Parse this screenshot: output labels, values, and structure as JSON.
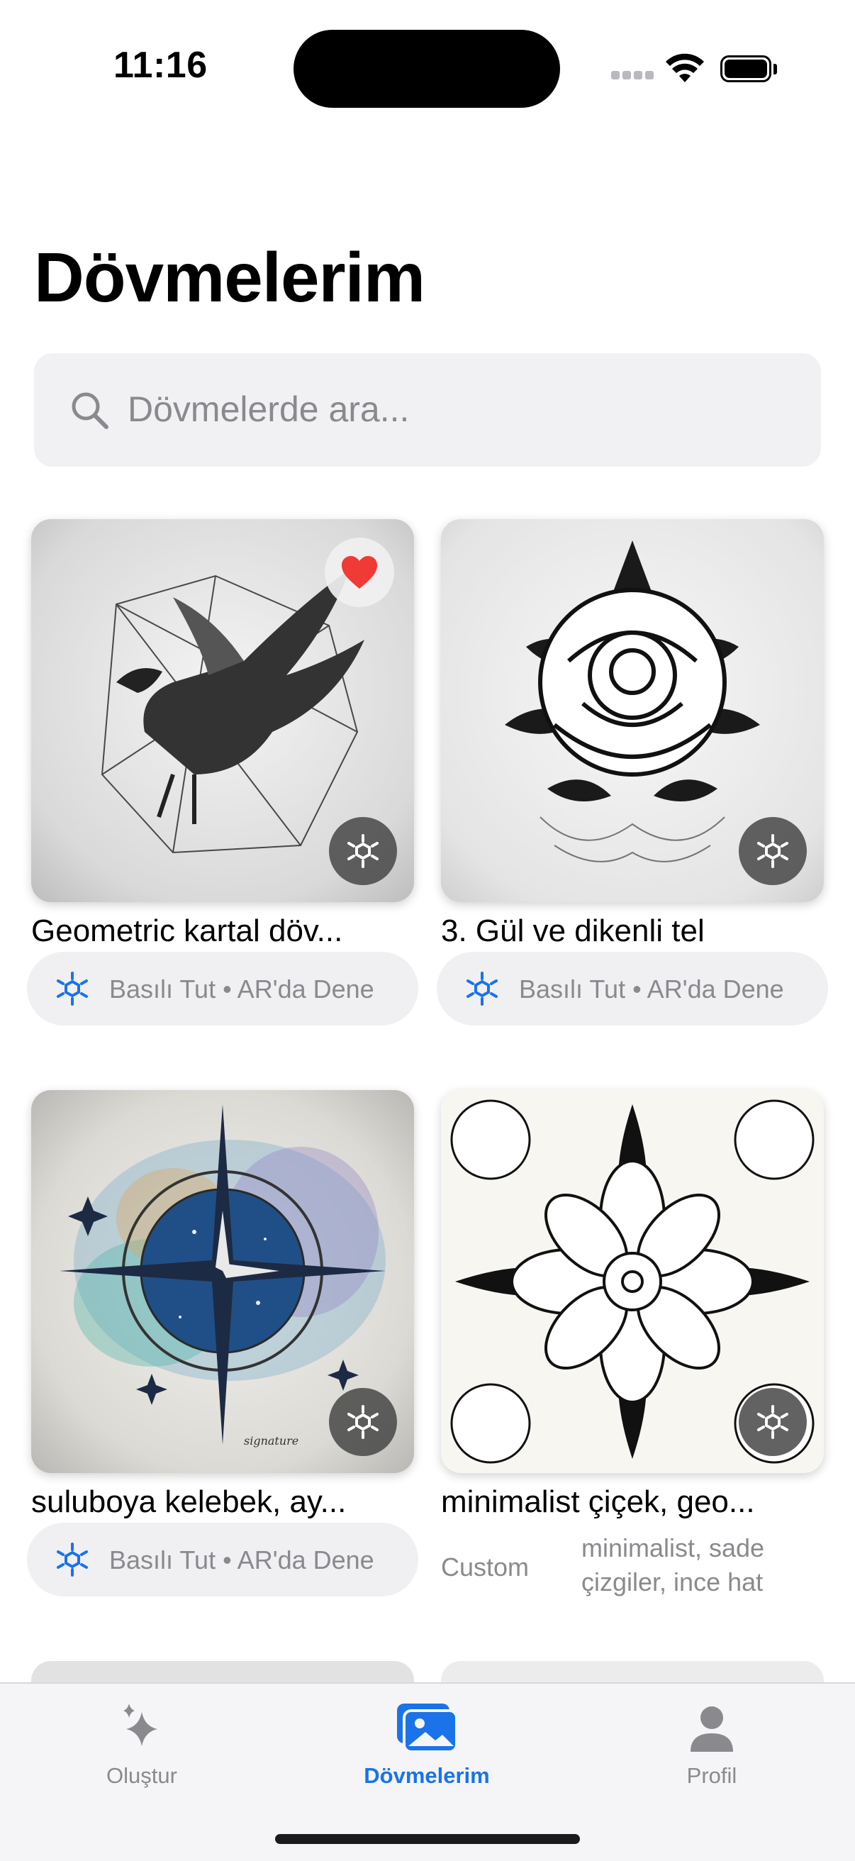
{
  "status": {
    "time": "11:16"
  },
  "header": {
    "title": "Dövmelerim"
  },
  "search": {
    "placeholder": "Dövmelerde ara..."
  },
  "cards": [
    {
      "title": "Geometric kartal döv...",
      "favorited": true,
      "ar_label": "Basılı Tut • AR'da Dene"
    },
    {
      "title": "3. Gül ve dikenli tel",
      "favorited": false,
      "ar_label": "Basılı Tut • AR'da Dene"
    },
    {
      "title": "suluboya kelebek, ay...",
      "favorited": false,
      "ar_label": "Basılı Tut • AR'da Dene"
    },
    {
      "title": "minimalist çiçek, geo...",
      "favorited": false,
      "style": "Custom",
      "tags_line1": "minimalist, sade",
      "tags_line2": "çizgiler, ince hat"
    }
  ],
  "tabs": [
    {
      "label": "Oluştur",
      "icon": "sparkles-icon",
      "active": false
    },
    {
      "label": "Dövmelerim",
      "icon": "photos-icon",
      "active": true
    },
    {
      "label": "Profil",
      "icon": "person-icon",
      "active": false
    }
  ],
  "colors": {
    "accent": "#1a73e8",
    "heart": "#f03a35",
    "ar_icon": "#1a73e8"
  }
}
